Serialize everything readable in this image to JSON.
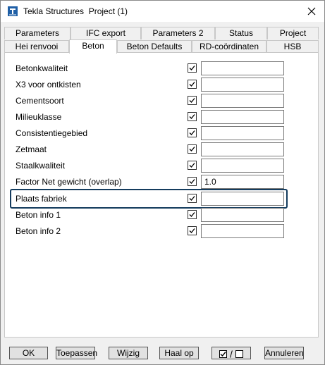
{
  "window": {
    "title": "Tekla Structures  Project (1)",
    "icon": "tekla-app-icon",
    "close_icon": "close-icon"
  },
  "tabs": {
    "row1": [
      "Parameters",
      "IFC export",
      "Parameters 2",
      "Status",
      "Project"
    ],
    "row2": [
      "Hei renvooi",
      "Beton",
      "Beton Defaults",
      "RD-coördinaten",
      "HSB"
    ],
    "active": "Beton"
  },
  "rows": [
    {
      "label": "Betonkwaliteit",
      "checked": true,
      "value": ""
    },
    {
      "label": "X3 voor ontkisten",
      "checked": true,
      "value": ""
    },
    {
      "label": "Cementsoort",
      "checked": true,
      "value": ""
    },
    {
      "label": "Milieuklasse",
      "checked": true,
      "value": ""
    },
    {
      "label": "Consistentiegebied",
      "checked": true,
      "value": ""
    },
    {
      "label": "Zetmaat",
      "checked": true,
      "value": ""
    },
    {
      "label": "Staalkwaliteit",
      "checked": true,
      "value": ""
    },
    {
      "label": "Factor Net gewicht (overlap)",
      "checked": true,
      "value": "1.0"
    },
    {
      "label": "Plaats fabriek",
      "checked": true,
      "value": "",
      "highlighted": true
    },
    {
      "label": "Beton info 1",
      "checked": true,
      "value": ""
    },
    {
      "label": "Beton info 2",
      "checked": true,
      "value": ""
    }
  ],
  "buttons": {
    "ok": "OK",
    "apply": "Toepassen",
    "modify": "Wijzig",
    "get": "Haal op",
    "toggle_separator": "/",
    "cancel": "Annuleren"
  },
  "colors": {
    "highlight_border": "#143c5e",
    "tekla_blue": "#1f5fa6"
  }
}
